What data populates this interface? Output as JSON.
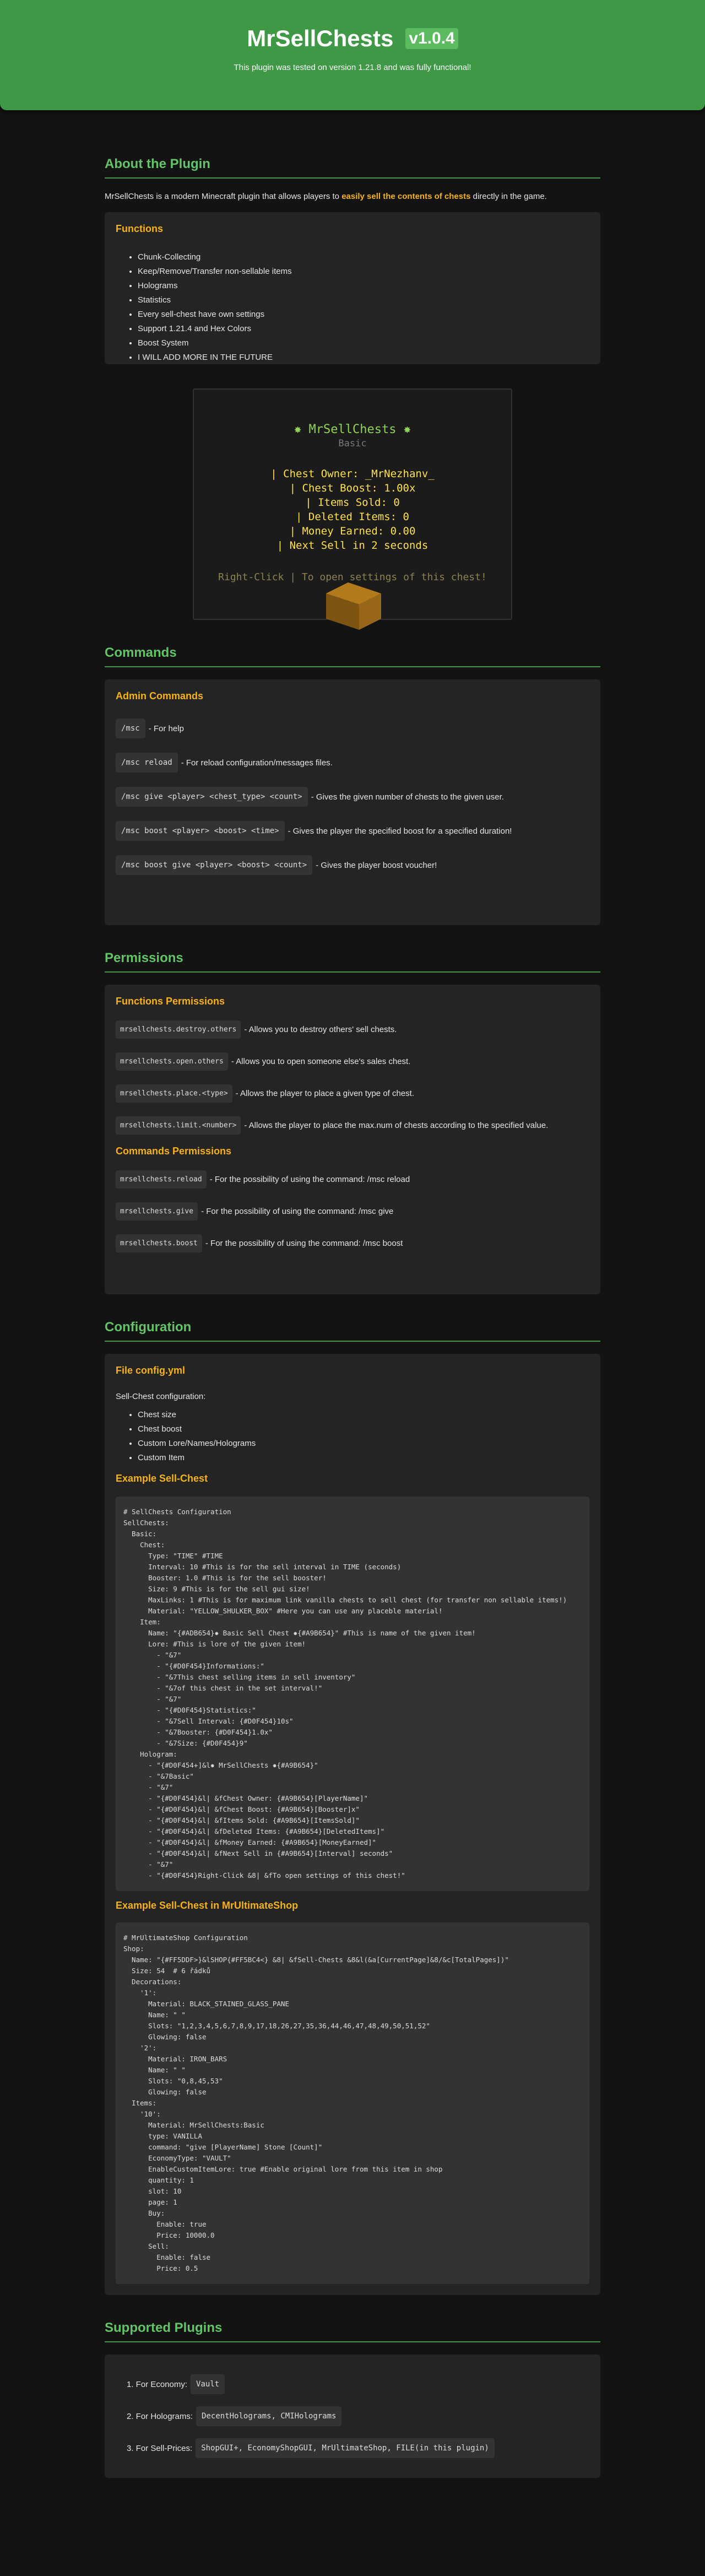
{
  "hero": {
    "title": "MrSellChests",
    "version": "v1.0.4",
    "tested": "This plugin was tested on version 1.21.8 and was fully functional!"
  },
  "about": {
    "heading": "About the Plugin",
    "intro_before": "MrSellChests is a modern Minecraft plugin that allows players to ",
    "intro_bold": "easily sell the contents of chests",
    "intro_after": " directly in the game.",
    "functions_title": "Functions",
    "functions": [
      "Chunk-Collecting",
      "Keep/Remove/Transfer non-sellable items",
      "Holograms",
      "Statistics",
      "Every sell-chest have own settings",
      "Support 1.21.4 and Hex Colors",
      "Boost System",
      "I WILL ADD MORE IN THE FUTURE"
    ]
  },
  "preview": {
    "title": "✸ MrSellChests ✸",
    "subtitle": "Basic",
    "lines": [
      "| Chest Owner: _MrNezhanv_",
      "| Chest Boost: 1.00x",
      "| Items Sold: 0",
      "| Deleted Items: 0",
      "| Money Earned: 0.00",
      "| Next Sell in 2 seconds"
    ],
    "hint": "Right-Click | To open settings of this chest!",
    "colors": {
      "title": "#8fd35a",
      "subtitle": "#7a7a7a",
      "bar": "#e6b422",
      "label": "#ffe14d",
      "value": "#a8a8a8",
      "hint": "#8d8250"
    }
  },
  "commands": {
    "heading": "Commands",
    "admin_title": "Admin Commands",
    "items": [
      {
        "cmd": "/msc",
        "desc": "- For help"
      },
      {
        "cmd": "/msc reload",
        "desc": "- For reload configuration/messages files."
      },
      {
        "cmd": "/msc give <player> <chest_type> <count>",
        "desc": "- Gives the given number of chests to the given user."
      },
      {
        "cmd": "/msc boost <player> <boost> <time>",
        "desc": "- Gives the player the specified boost for a specified duration!"
      },
      {
        "cmd": "/msc boost give <player> <boost> <count>",
        "desc": "- Gives the player boost voucher!"
      }
    ]
  },
  "permissions": {
    "heading": "Permissions",
    "functions_title": "Functions Permissions",
    "functions": [
      {
        "perm": "mrsellchests.destroy.others",
        "desc": "- Allows you to destroy others' sell chests."
      },
      {
        "perm": "mrsellchests.open.others",
        "desc": "- Allows you to open someone else's sales chest."
      },
      {
        "perm": "mrsellchests.place.<type>",
        "desc": "- Allows the player to place a given type of chest."
      },
      {
        "perm": "mrsellchests.limit.<number>",
        "desc": "- Allows the player to place the max.num of chests according to the specified value."
      }
    ],
    "commands_title": "Commands Permissions",
    "commands": [
      {
        "perm": "mrsellchests.reload",
        "desc": "- For the possibility of using the command: /msc reload"
      },
      {
        "perm": "mrsellchests.give",
        "desc": "- For the possibility of using the command: /msc give"
      },
      {
        "perm": "mrsellchests.boost",
        "desc": "- For the possibility of using the command: /msc boost"
      }
    ]
  },
  "configuration": {
    "heading": "Configuration",
    "file_title": "File config.yml",
    "sell_chest_label": "Sell-Chest configuration:",
    "sell_chest_items": [
      "Chest size",
      "Chest boost",
      "Custom Lore/Names/Holograms",
      "Custom Item"
    ],
    "example1_title": "Example Sell-Chest",
    "example1_code": "# SellChests Configuration\nSellChests:\n  Basic:\n    Chest:\n      Type: \"TIME\" #TIME\n      Interval: 10 #This is for the sell interval in TIME (seconds)\n      Booster: 1.0 #This is for the sell booster!\n      Size: 9 #This is for the sell gui size!\n      MaxLinks: 1 #This is for maximum link vanilla chests to sell chest (for transfer non sellable items!)\n      Material: \"YELLOW_SHULKER_BOX\" #Here you can use any placeble material!\n    Item:\n      Name: \"{#ADB654}✸ Basic Sell Chest ✸{#A9B654}\" #This is name of the given item!\n      Lore: #This is lore of the given item!\n        - \"&7\"\n        - \"{#D0F454}Informations:\"\n        - \"&7This chest selling items in sell inventory\"\n        - \"&7of this chest in the set interval!\"\n        - \"&7\"\n        - \"{#D0F454}Statistics:\"\n        - \"&7Sell Interval: {#D0F454}10s\"\n        - \"&7Booster: {#D0F454}1.0x\"\n        - \"&7Size: {#D0F454}9\"\n    Hologram:\n      - \"{#D0F454+]&l✸ MrSellChests ✸{#A9B654}\"\n      - \"&7Basic\"\n      - \"&7\"\n      - \"{#D0F454}&l| &fChest Owner: {#A9B654}[PlayerName]\"\n      - \"{#D0F454}&l| &fChest Boost: {#A9B654}[Booster]x\"\n      - \"{#D0F454}&l| &fItems Sold: {#A9B654}[ItemsSold]\"\n      - \"{#D0F454}&l| &fDeleted Items: {#A9B654}[DeletedItems]\"\n      - \"{#D0F454}&l| &fMoney Earned: {#A9B654}[MoneyEarned]\"\n      - \"{#D0F454}&l| &fNext Sell in {#A9B654}[Interval] seconds\"\n      - \"&7\"\n      - \"{#D0F454}Right-Click &8| &fTo open settings of this chest!\"",
    "example2_title": "Example Sell-Chest in MrUltimateShop",
    "example2_code": "# MrUltimateShop Configuration\nShop:\n  Name: \"{#FF5DDF>}&lSHOP{#FF5BC4<} &8| &fSell-Chests &8&l(&a[CurrentPage]&8/&c[TotalPages])\"\n  Size: 54  # 6 řádků\n  Decorations:\n    '1':\n      Material: BLACK_STAINED_GLASS_PANE\n      Name: \" \"\n      Slots: \"1,2,3,4,5,6,7,8,9,17,18,26,27,35,36,44,46,47,48,49,50,51,52\"\n      Glowing: false\n    '2':\n      Material: IRON_BARS\n      Name: \" \"\n      Slots: \"0,8,45,53\"\n      Glowing: false\n  Items:\n    '10':\n      Material: MrSellChests:Basic\n      type: VANILLA\n      command: \"give [PlayerName] Stone [Count]\"\n      EconomyType: \"VAULT\"\n      EnableCustomItemLore: true #Enable original lore from this item in shop\n      quantity: 1\n      slot: 10\n      page: 1\n      Buy:\n        Enable: true\n        Price: 10000.0\n      Sell:\n        Enable: false\n        Price: 0.5"
  },
  "supported": {
    "heading": "Supported Plugins",
    "items": [
      {
        "label": "1. For Economy:",
        "value": "Vault"
      },
      {
        "label": "2. For Holograms:",
        "value": "DecentHolograms, CMIHolograms"
      },
      {
        "label": "3. For Sell-Prices:",
        "value": "ShopGUI+, EconomyShopGUI, MrUltimateShop, FILE(in this plugin)"
      }
    ]
  },
  "colors": {
    "accent": "#3f9845",
    "heading": "#62c466",
    "subheading": "#f6b21b",
    "background": "#131313",
    "card": "#242424"
  }
}
